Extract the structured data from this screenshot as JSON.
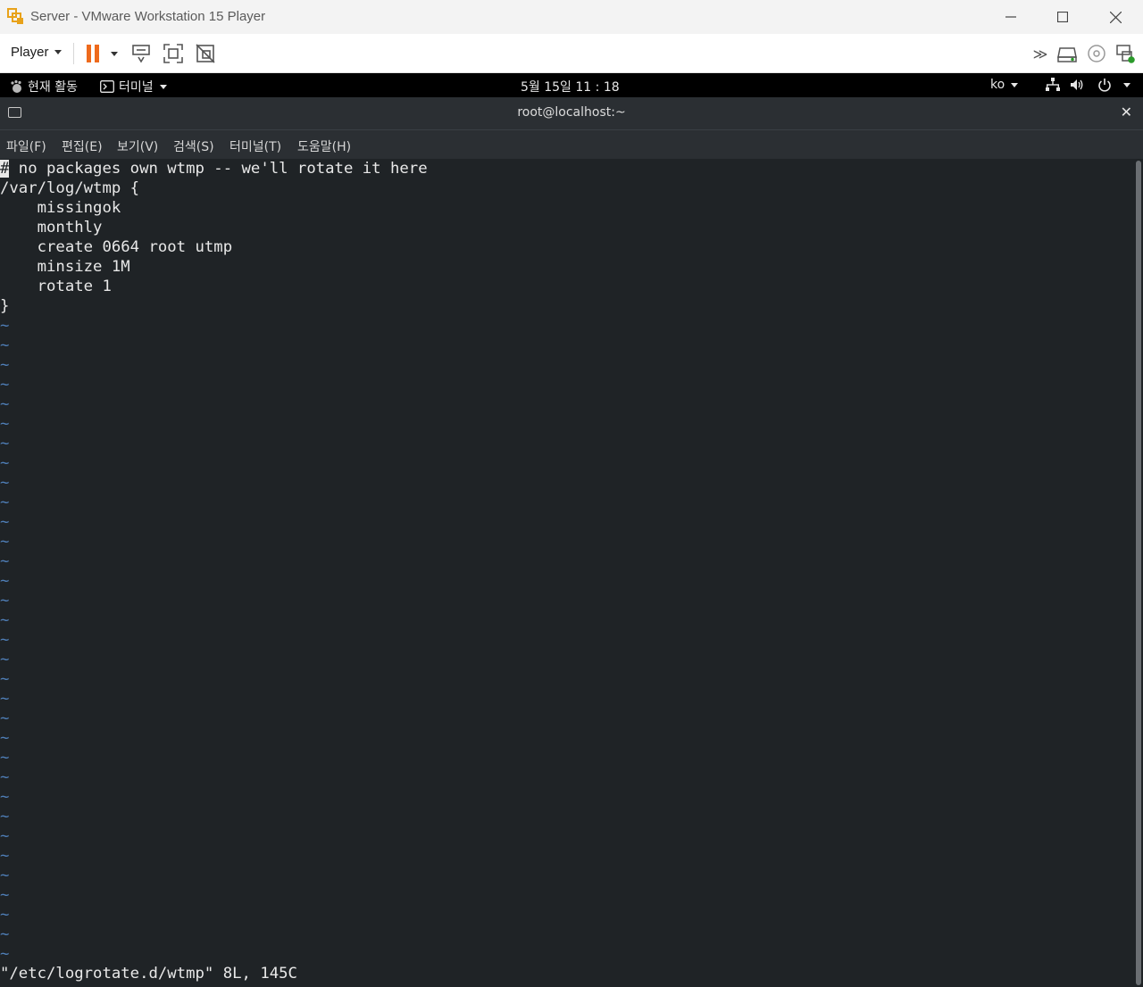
{
  "window": {
    "title": "Server - VMware Workstation 15 Player"
  },
  "toolbar": {
    "player_label": "Player",
    "accent_color": "#ee6a1c",
    "right_icons": [
      "send-key-icon",
      "hard-disk-icon",
      "cd-drive-icon",
      "network-adapter-icon"
    ]
  },
  "gnome": {
    "activities": "현재 활동",
    "app_menu": "터미널",
    "clock": "5월 15일  11 : 18",
    "lang": "ko"
  },
  "terminal": {
    "title": "root@localhost:~",
    "menu": [
      "파일(F)",
      "편집(E)",
      "보기(V)",
      "검색(S)",
      "터미널(T)",
      "도움말(H)"
    ],
    "cursor_char": "#",
    "lines": [
      " no packages own wtmp -- we'll rotate it here",
      "/var/log/wtmp {",
      "    missingok",
      "    monthly",
      "    create 0664 root utmp",
      "    minsize 1M",
      "    rotate 1",
      "}"
    ],
    "tilde_char": "~",
    "status_line": "\"/etc/logrotate.d/wtmp\" 8L, 145C"
  }
}
